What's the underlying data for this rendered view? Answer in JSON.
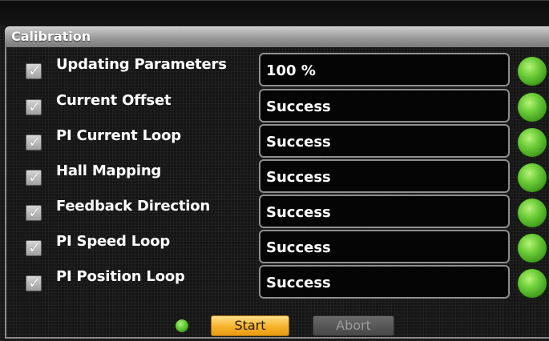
{
  "panel": {
    "title": "Calibration"
  },
  "steps": [
    {
      "label": "Updating Parameters",
      "checked": true,
      "value": "100 %",
      "status_color": "#5fcf2e"
    },
    {
      "label": "Current Offset",
      "checked": true,
      "value": "Success",
      "status_color": "#5fcf2e"
    },
    {
      "label": "PI Current Loop",
      "checked": true,
      "value": "Success",
      "status_color": "#5fcf2e"
    },
    {
      "label": "Hall Mapping",
      "checked": true,
      "value": "Success",
      "status_color": "#5fcf2e"
    },
    {
      "label": "Feedback Direction",
      "checked": true,
      "value": "Success",
      "status_color": "#5fcf2e"
    },
    {
      "label": "PI Speed Loop",
      "checked": true,
      "value": "Success",
      "status_color": "#5fcf2e"
    },
    {
      "label": "PI Position Loop",
      "checked": true,
      "value": "Success",
      "status_color": "#5fcf2e"
    }
  ],
  "footer": {
    "indicator_color": "#58c22c",
    "start_label": "Start",
    "abort_label": "Abort",
    "abort_enabled": false
  },
  "colors": {
    "accent": "#f6b22a",
    "background": "#161616"
  }
}
